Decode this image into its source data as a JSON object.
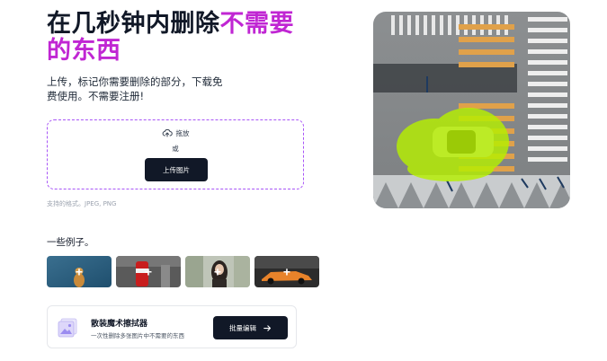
{
  "hero": {
    "title_part1": "在几秒钟内删除",
    "title_accent": "不需要",
    "title_part2": "的东西",
    "subtitle": "上传，标记你需要删除的部分，下载免费使用。不需要注册!"
  },
  "dropzone": {
    "drag_label": "拖放",
    "or_label": "或",
    "upload_button": "上传图片",
    "upload_icon": "cloud-upload-icon"
  },
  "formats_note": "支持的格式。JPEG, PNG",
  "examples": {
    "label": "一些例子。",
    "items": [
      {
        "name": "example-dog",
        "plus": "+"
      },
      {
        "name": "example-cola",
        "plus": "+"
      },
      {
        "name": "example-woman",
        "plus": "+"
      },
      {
        "name": "example-car",
        "plus": "+"
      }
    ]
  },
  "batch": {
    "title": "散装魔术擦拭器",
    "description": "一次性删除多张图片中不需要的东西",
    "button": "批量编辑",
    "button_icon": "arrow-right-icon"
  },
  "colors": {
    "accent": "#c026d3",
    "dark_button": "#111827",
    "dashed_border": "#a855f7",
    "highlight_mask": "#b6f000"
  }
}
